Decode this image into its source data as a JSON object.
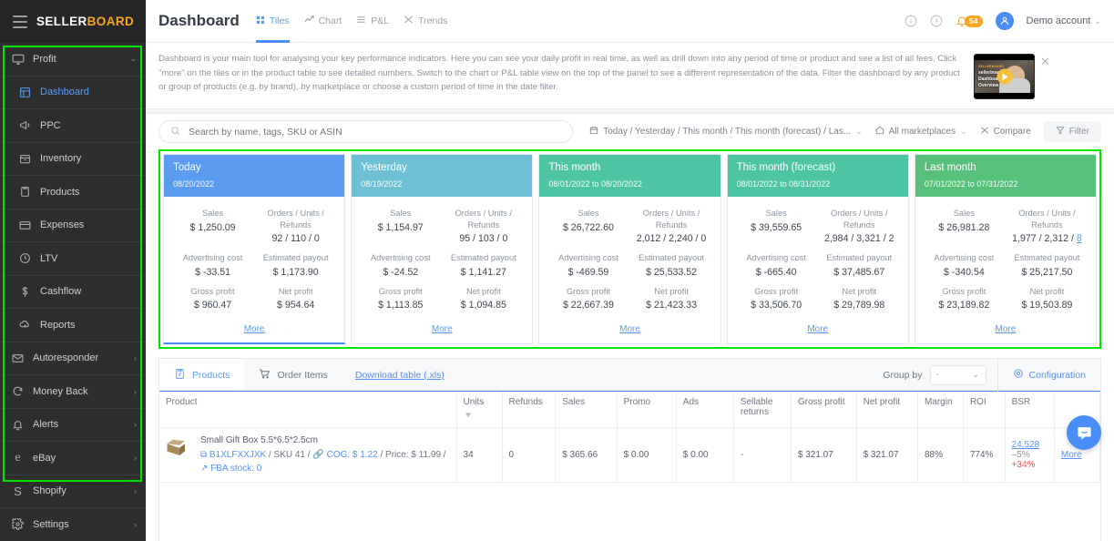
{
  "brand": {
    "part1": "SELLER",
    "part2": "BOARD"
  },
  "sidebar": {
    "items": [
      {
        "label": "Profit",
        "icon": "monitor-icon",
        "type": "group",
        "expanded": true,
        "chevron": "⌄"
      },
      {
        "label": "Dashboard",
        "icon": "dashboard-grid-icon",
        "type": "sub",
        "active": true
      },
      {
        "label": "PPC",
        "icon": "megaphone-icon",
        "type": "sub"
      },
      {
        "label": "Inventory",
        "icon": "inventory-box-icon",
        "type": "sub"
      },
      {
        "label": "Products",
        "icon": "clipboard-icon",
        "type": "sub"
      },
      {
        "label": "Expenses",
        "icon": "card-icon",
        "type": "sub"
      },
      {
        "label": "LTV",
        "icon": "clock-icon",
        "type": "sub"
      },
      {
        "label": "Cashflow",
        "icon": "dollar-icon",
        "type": "sub"
      },
      {
        "label": "Reports",
        "icon": "cloud-download-icon",
        "type": "sub"
      },
      {
        "label": "Autoresponder",
        "icon": "envelope-icon",
        "type": "group",
        "chevron": "›"
      },
      {
        "label": "Money Back",
        "icon": "refresh-icon",
        "type": "group",
        "chevron": "›"
      },
      {
        "label": "Alerts",
        "icon": "bell-icon",
        "type": "group",
        "chevron": "›"
      },
      {
        "label": "eBay",
        "icon": "ebay-icon",
        "type": "group",
        "chevron": "›"
      },
      {
        "label": "Shopify",
        "icon": "shopify-icon",
        "type": "group",
        "chevron": "›"
      },
      {
        "label": "Settings",
        "icon": "gear-icon",
        "type": "group",
        "chevron": "›"
      }
    ]
  },
  "header": {
    "title": "Dashboard",
    "tabs": [
      {
        "label": "Tiles",
        "icon": "tiles-icon",
        "active": true
      },
      {
        "label": "Chart",
        "icon": "line-chart-icon",
        "active": false
      },
      {
        "label": "P&L",
        "icon": "list-icon",
        "active": false
      },
      {
        "label": "Trends",
        "icon": "trends-icon",
        "active": false
      }
    ],
    "info_icon": "info-circle-icon",
    "history_icon": "clock-circle-icon",
    "bell_icon": "bell-icon",
    "notification_count": "54",
    "avatar_icon": "user-avatar-icon",
    "account": "Demo account",
    "account_chevron": "⌄"
  },
  "description": "Dashboard is your main tool for analysing your key performance indicators. Here you can see your daily profit in real time, as well as drill down into any period of time or product and see a list of all fees. Click \"more\" on the tiles or in the product table to see detailed numbers. Switch to the chart or P&L table view on the top of the panel to see a different representation of the data. Filter the dashboard by any product or group of products (e.g. by brand), by marketplace or choose a custom period of time in the date filter.",
  "video": {
    "logo": "SELLERBOARD",
    "title": "sellerboard\nDashboard\nOverview",
    "play_icon": "play-icon",
    "close_icon": "close-icon"
  },
  "filters": {
    "search_icon": "search-icon",
    "search_placeholder": "Search by name, tags, SKU or ASIN",
    "search_value": "",
    "date_icon": "calendar-icon",
    "date_label": "Today / Yesterday / This month / This month (forecast) / Las...",
    "marketplace_icon": "marketplace-icon",
    "marketplace_label": "All marketplaces",
    "compare_icon": "compare-icon",
    "compare_label": "Compare",
    "filter_icon": "funnel-icon",
    "filter_label": "Filter"
  },
  "tiles": [
    {
      "title": "Today",
      "range": "08/20/2022",
      "color": "#5b9bf0",
      "metrics": [
        {
          "label": "Sales",
          "value": "$ 1,250.09"
        },
        {
          "label": "Orders / Units / Refunds",
          "value": "92 / 110 / 0"
        },
        {
          "label": "Advertising cost",
          "value": "$ -33.51"
        },
        {
          "label": "Estimated payout",
          "value": "$ 1,173.90"
        },
        {
          "label": "Gross profit",
          "value": "$ 960.47"
        },
        {
          "label": "Net profit",
          "value": "$ 954.64"
        }
      ],
      "more": "More"
    },
    {
      "title": "Yesterday",
      "range": "08/19/2022",
      "color": "#6ec1d4",
      "metrics": [
        {
          "label": "Sales",
          "value": "$ 1,154.97"
        },
        {
          "label": "Orders / Units / Refunds",
          "value": "95 / 103 / 0"
        },
        {
          "label": "Advertising cost",
          "value": "$ -24.52"
        },
        {
          "label": "Estimated payout",
          "value": "$ 1,141.27"
        },
        {
          "label": "Gross profit",
          "value": "$ 1,113.85"
        },
        {
          "label": "Net profit",
          "value": "$ 1,094.85"
        }
      ],
      "more": "More"
    },
    {
      "title": "This month",
      "range": "08/01/2022 to 08/20/2022",
      "color": "#4dc4a4",
      "metrics": [
        {
          "label": "Sales",
          "value": "$ 26,722.60"
        },
        {
          "label": "Orders / Units / Refunds",
          "value": "2,012 / 2,240 / 0"
        },
        {
          "label": "Advertising cost",
          "value": "$ -469.59"
        },
        {
          "label": "Estimated payout",
          "value": "$ 25,533.52"
        },
        {
          "label": "Gross profit",
          "value": "$ 22,667.39"
        },
        {
          "label": "Net profit",
          "value": "$ 21,423.33"
        }
      ],
      "more": "More"
    },
    {
      "title": "This month (forecast)",
      "range": "08/01/2022 to 08/31/2022",
      "color": "#4dc4a4",
      "metrics": [
        {
          "label": "Sales",
          "value": "$ 39,559.65"
        },
        {
          "label": "Orders / Units / Refunds",
          "value": "2,984 / 3,321 / 2"
        },
        {
          "label": "Advertising cost",
          "value": "$ -665.40"
        },
        {
          "label": "Estimated payout",
          "value": "$ 37,485.67"
        },
        {
          "label": "Gross profit",
          "value": "$ 33,506.70"
        },
        {
          "label": "Net profit",
          "value": "$ 29,789.98"
        }
      ],
      "more": "More"
    },
    {
      "title": "Last month",
      "range": "07/01/2022 to 07/31/2022",
      "color": "#57c17b",
      "metrics": [
        {
          "label": "Sales",
          "value": "$ 26,981.28"
        },
        {
          "label": "Orders / Units / Refunds",
          "value": "1,977 / 2,312 / 8",
          "link_tail": "8"
        },
        {
          "label": "Advertising cost",
          "value": "$ -340.54"
        },
        {
          "label": "Estimated payout",
          "value": "$ 25,217.50"
        },
        {
          "label": "Gross profit",
          "value": "$ 23,189.82"
        },
        {
          "label": "Net profit",
          "value": "$ 19,503.89"
        }
      ],
      "more": "More"
    }
  ],
  "table_panel": {
    "tabs": [
      {
        "label": "Products",
        "icon": "clipboard-icon",
        "active": true
      },
      {
        "label": "Order Items",
        "icon": "cart-icon",
        "active": false
      }
    ],
    "download_label": "Download table (.xls)",
    "group_by_label": "Group by",
    "group_by_value": "-",
    "group_by_chevron": "⌄",
    "configuration_icon": "gear-icon",
    "configuration_label": "Configuration",
    "columns": [
      "Product",
      "Units",
      "Refunds",
      "Sales",
      "Promo",
      "Ads",
      "Sellable returns",
      "Gross profit",
      "Net profit",
      "Margin",
      "ROI",
      "BSR",
      ""
    ],
    "rows": [
      {
        "product_title": "Small Gift Box 5.5*6.5*2.5cm",
        "product_meta_asin": "B1XLFXXJXK",
        "product_meta_sku": "SKU 41",
        "product_meta_cog": "COG: $ 1.22",
        "product_meta_price": "Price: $ 11.99",
        "product_meta_fba": "FBA stock: 0",
        "units": "34",
        "refunds": "0",
        "sales": "$ 365.66",
        "promo": "$ 0.00",
        "ads": "$ 0.00",
        "sellable_returns": "-",
        "gross_profit": "$ 321.07",
        "net_profit": "$ 321.07",
        "margin": "88%",
        "roi": "774%",
        "bsr_value": "24,528",
        "bsr_change1": "–5%",
        "bsr_change2": "+34%",
        "more": "More"
      }
    ]
  },
  "chat_icon": "chat-bubble-icon"
}
